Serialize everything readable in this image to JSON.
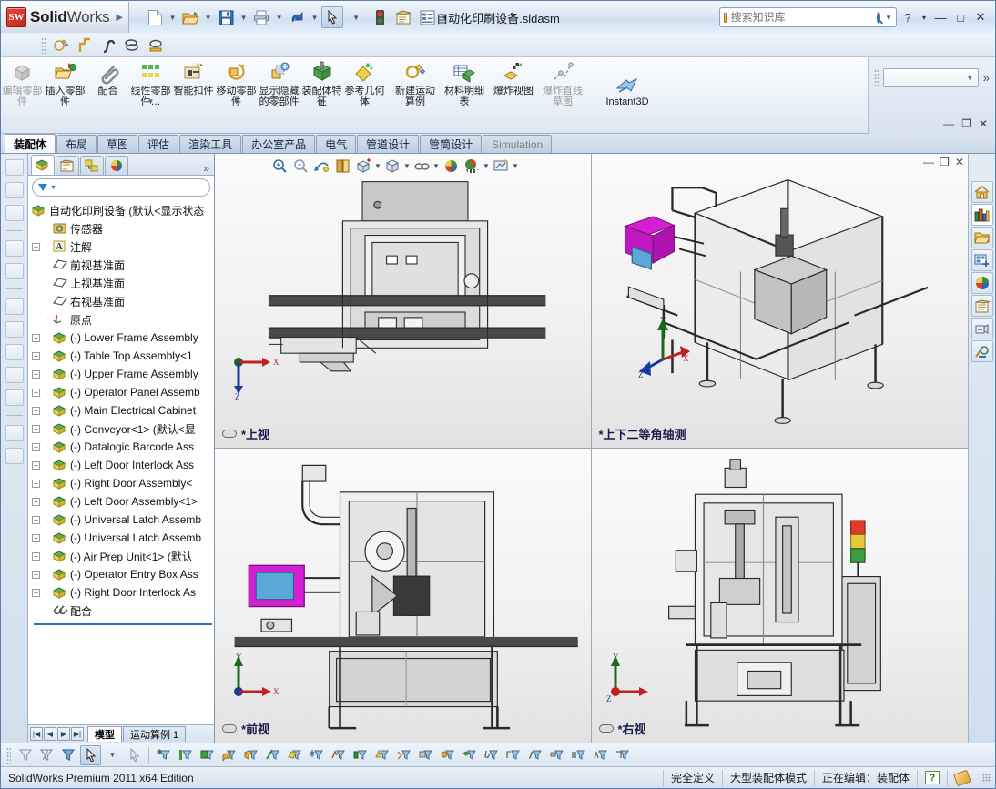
{
  "app": {
    "brand_bold": "Solid",
    "brand_light": "Works",
    "logo_text": "SW",
    "document_title": "自动化印刷设备.sldasm",
    "accent": "#2c6fc0",
    "brand_red": "#c0261b"
  },
  "search": {
    "placeholder": "搜索知识库",
    "value": "",
    "icon": "search-icon",
    "folder_icon": "folder-icon"
  },
  "window_controls": {
    "help": "?",
    "help_caret": "▾",
    "minimize": "—",
    "maximize": "□",
    "close": "✕"
  },
  "quick_access": [
    {
      "name": "new-document",
      "icon": "new-doc-icon",
      "caret": true
    },
    {
      "name": "open-document",
      "icon": "open-folder-icon",
      "caret": true
    },
    {
      "name": "save-document",
      "icon": "save-disk-icon",
      "caret": true
    },
    {
      "name": "print-document",
      "icon": "printer-icon",
      "caret": true
    },
    {
      "name": "undo",
      "icon": "undo-arrow-icon",
      "caret": true
    },
    {
      "name": "select-tool",
      "icon": "cursor-arrow-icon",
      "caret": true
    },
    {
      "name": "rebuild",
      "icon": "traffic-light-icon",
      "caret": false
    },
    {
      "name": "options",
      "icon": "options-gear-icon",
      "caret": false
    },
    {
      "name": "properties",
      "icon": "properties-list-icon",
      "caret": true
    }
  ],
  "toolbar2": [
    {
      "name": "new-motion-study",
      "icon": "motion-study-icon"
    },
    {
      "name": "curve-step",
      "icon": "step-curve-icon"
    },
    {
      "name": "curve-spline",
      "icon": "spline-curve-icon"
    },
    {
      "name": "curve-helix",
      "icon": "helix-curve-icon"
    },
    {
      "name": "curve-projected",
      "icon": "projected-curve-icon"
    }
  ],
  "ribbon": {
    "commands": [
      {
        "label": "编辑零部件",
        "icon": "edit-component-icon",
        "dropdown": false,
        "dimmed": true
      },
      {
        "label": "插入零部件",
        "icon": "insert-component-icon",
        "dropdown": true,
        "dimmed": false
      },
      {
        "label": "配合",
        "icon": "mate-paperclip-icon",
        "dropdown": false,
        "dimmed": false
      },
      {
        "label": "线性零部件…",
        "icon": "linear-pattern-icon",
        "dropdown": true,
        "dimmed": false
      },
      {
        "label": "智能扣件",
        "icon": "smart-fastener-icon",
        "dropdown": false,
        "dimmed": false
      },
      {
        "label": "移动零部件",
        "icon": "move-component-icon",
        "dropdown": true,
        "dimmed": false
      },
      {
        "label": "显示隐藏的零部件",
        "icon": "show-hidden-components-icon",
        "dropdown": false,
        "dimmed": false
      },
      {
        "label": "装配体特征",
        "icon": "assembly-feature-icon",
        "dropdown": true,
        "dimmed": false
      },
      {
        "label": "参考几何体",
        "icon": "reference-geometry-icon",
        "dropdown": true,
        "dimmed": false
      },
      {
        "label": "新建运动算例",
        "icon": "new-motion-study-icon",
        "dropdown": false,
        "dimmed": false
      },
      {
        "label": "材料明细表",
        "icon": "bill-of-materials-icon",
        "dropdown": false,
        "dimmed": false
      },
      {
        "label": "爆炸视图",
        "icon": "exploded-view-icon",
        "dropdown": false,
        "dimmed": false
      },
      {
        "label": "爆炸直线草图",
        "icon": "explode-line-sketch-icon",
        "dropdown": false,
        "dimmed": true
      },
      {
        "label": "Instant3D",
        "icon": "instant3d-icon",
        "dropdown": false,
        "dimmed": false
      }
    ],
    "config_combo_value": "",
    "expand_label": "»"
  },
  "tabs": [
    {
      "label": "装配体",
      "active": true,
      "dimmed": false
    },
    {
      "label": "布局",
      "active": false,
      "dimmed": false
    },
    {
      "label": "草图",
      "active": false,
      "dimmed": false
    },
    {
      "label": "评估",
      "active": false,
      "dimmed": false
    },
    {
      "label": "渲染工具",
      "active": false,
      "dimmed": false
    },
    {
      "label": "办公室产品",
      "active": false,
      "dimmed": false
    },
    {
      "label": "电气",
      "active": false,
      "dimmed": false
    },
    {
      "label": "管道设计",
      "active": false,
      "dimmed": false
    },
    {
      "label": "管筒设计",
      "active": false,
      "dimmed": false
    },
    {
      "label": "Simulation",
      "active": false,
      "dimmed": true
    }
  ],
  "tree_panel": {
    "tabs": [
      {
        "name": "feature-manager-tab",
        "icon": "feature-tree-icon",
        "active": true
      },
      {
        "name": "property-manager-tab",
        "icon": "property-manager-icon",
        "active": false
      },
      {
        "name": "configuration-manager-tab",
        "icon": "configuration-manager-icon",
        "active": false
      },
      {
        "name": "display-manager-tab",
        "icon": "display-manager-icon",
        "active": false
      }
    ],
    "more": "»",
    "filter_placeholder": "",
    "items": [
      {
        "label": "自动化印刷设备  (默认<显示状态",
        "icon": "assembly-icon",
        "expandable": false,
        "root": true
      },
      {
        "label": "传感器",
        "icon": "sensors-folder-icon",
        "expandable": false,
        "indent": 1
      },
      {
        "label": "注解",
        "icon": "annotations-icon",
        "expandable": true,
        "indent": 1
      },
      {
        "label": "前视基准面",
        "icon": "plane-icon",
        "expandable": false,
        "indent": 1
      },
      {
        "label": "上视基准面",
        "icon": "plane-icon",
        "expandable": false,
        "indent": 1
      },
      {
        "label": "右视基准面",
        "icon": "plane-icon",
        "expandable": false,
        "indent": 1
      },
      {
        "label": "原点",
        "icon": "origin-icon",
        "expandable": false,
        "indent": 1
      },
      {
        "label": "(-) Lower Frame Assembly",
        "icon": "component-icon",
        "expandable": true,
        "indent": 1
      },
      {
        "label": "(-) Table Top Assembly<1",
        "icon": "component-icon",
        "expandable": true,
        "indent": 1
      },
      {
        "label": "(-) Upper Frame Assembly",
        "icon": "component-icon",
        "expandable": true,
        "indent": 1
      },
      {
        "label": "(-) Operator Panel Assemb",
        "icon": "component-icon",
        "expandable": true,
        "indent": 1
      },
      {
        "label": "(-) Main Electrical Cabinet",
        "icon": "component-icon",
        "expandable": true,
        "indent": 1
      },
      {
        "label": "(-) Conveyor<1> (默认<显",
        "icon": "component-icon",
        "expandable": true,
        "indent": 1
      },
      {
        "label": "(-) Datalogic Barcode Ass",
        "icon": "component-icon",
        "expandable": true,
        "indent": 1
      },
      {
        "label": "(-) Left Door Interlock Ass",
        "icon": "component-icon",
        "expandable": true,
        "indent": 1
      },
      {
        "label": "(-) Right Door Assembly<",
        "icon": "component-icon",
        "expandable": true,
        "indent": 1
      },
      {
        "label": "(-) Left Door Assembly<1>",
        "icon": "component-icon",
        "expandable": true,
        "indent": 1
      },
      {
        "label": "(-) Universal Latch Assemb",
        "icon": "component-icon",
        "expandable": true,
        "indent": 1
      },
      {
        "label": "(-) Universal Latch Assemb",
        "icon": "component-icon",
        "expandable": true,
        "indent": 1
      },
      {
        "label": "(-) Air Prep Unit<1> (默认",
        "icon": "component-icon",
        "expandable": true,
        "indent": 1
      },
      {
        "label": "(-) Operator Entry Box Ass",
        "icon": "component-icon",
        "expandable": true,
        "indent": 1
      },
      {
        "label": "(-) Right Door Interlock As",
        "icon": "component-icon",
        "expandable": true,
        "indent": 1
      },
      {
        "label": "配合",
        "icon": "mates-folder-icon",
        "expandable": false,
        "indent": 1
      }
    ],
    "bottom_tabs": [
      {
        "label": "模型",
        "active": true
      },
      {
        "label": "运动算例 1",
        "active": false
      }
    ],
    "nav_buttons": [
      "|◀",
      "◀",
      "▶",
      "▶|"
    ]
  },
  "viewport_toolbar": [
    {
      "name": "zoom-in-out-button",
      "icon": "zoom-in-out-icon",
      "caret": false
    },
    {
      "name": "zoom-to-area-button",
      "icon": "zoom-to-area-icon",
      "caret": false
    },
    {
      "name": "previous-view-button",
      "icon": "previous-view-icon",
      "caret": false
    },
    {
      "name": "section-view-button",
      "icon": "section-view-icon",
      "caret": false
    },
    {
      "name": "view-orientation-button",
      "icon": "view-orientation-icon",
      "caret": true
    },
    {
      "name": "display-style-button",
      "icon": "display-style-icon",
      "caret": true
    },
    {
      "name": "hide-show-items-button",
      "icon": "hide-show-items-icon",
      "caret": true
    },
    {
      "name": "apply-scene-button",
      "icon": "apply-scene-icon",
      "caret": false
    },
    {
      "name": "view-setting-button",
      "icon": "view-setting-icon",
      "caret": true
    },
    {
      "name": "display-state-button",
      "icon": "display-state-icon",
      "caret": true
    }
  ],
  "viewport_window_controls": {
    "minimize": "—",
    "restore": "❐",
    "close": "✕"
  },
  "viewports": [
    {
      "label": "*上视",
      "name": "viewport-top",
      "triad": "top"
    },
    {
      "label": "*上下二等角轴测",
      "name": "viewport-dimetric",
      "triad": "iso"
    },
    {
      "label": "*前视",
      "name": "viewport-front",
      "triad": "front"
    },
    {
      "label": "*右视",
      "name": "viewport-right",
      "triad": "right"
    }
  ],
  "task_pane": [
    {
      "name": "solidworks-resources-button",
      "icon": "home-icon",
      "active": false
    },
    {
      "name": "design-library-button",
      "icon": "design-library-icon",
      "active": true
    },
    {
      "name": "file-explorer-button",
      "icon": "folder-icon",
      "active": false
    },
    {
      "name": "view-palette-button",
      "icon": "view-palette-icon",
      "active": false
    },
    {
      "name": "appearances-scenes-button",
      "icon": "appearances-icon",
      "active": false
    },
    {
      "name": "custom-properties-button",
      "icon": "custom-properties-icon",
      "active": false
    },
    {
      "name": "document-recovery-button",
      "icon": "document-recovery-icon",
      "active": false
    },
    {
      "name": "simulation-button",
      "icon": "simulation-icon",
      "active": false
    }
  ],
  "bottom_toolbar": [
    {
      "name": "filter-off-button",
      "icon": "filter-icon",
      "selected": false
    },
    {
      "name": "filter-clear-button",
      "icon": "filter-clear-icon",
      "selected": false
    },
    {
      "name": "filter-toggle-button",
      "icon": "filter-toggle-icon",
      "selected": false
    },
    {
      "name": "select-arrow-button",
      "icon": "cursor-arrow-icon",
      "selected": true
    },
    {
      "name": "select-dropdown-button",
      "icon": "chevron-down-icon",
      "selected": false
    },
    {
      "name": "select-other-button",
      "icon": "cursor-outline-icon",
      "selected": false
    },
    {
      "name": "filter-vertices-button",
      "icon": "filter-vertex-icon",
      "selected": false
    },
    {
      "name": "filter-edges-button",
      "icon": "filter-edge-icon",
      "selected": false
    },
    {
      "name": "filter-faces-button",
      "icon": "filter-face-icon",
      "selected": false
    },
    {
      "name": "filter-surface-bodies-button",
      "icon": "filter-surface-icon",
      "selected": false
    },
    {
      "name": "filter-solid-bodies-button",
      "icon": "filter-solid-icon",
      "selected": false
    },
    {
      "name": "filter-axes-button",
      "icon": "filter-axis-icon",
      "selected": false
    },
    {
      "name": "filter-planes-button",
      "icon": "filter-plane-icon",
      "selected": false
    },
    {
      "name": "filter-points-button",
      "icon": "filter-point-icon",
      "selected": false
    },
    {
      "name": "filter-sketch-button",
      "icon": "filter-sketch-icon",
      "selected": false
    },
    {
      "name": "filter-dimensions-button",
      "icon": "filter-dimension-icon",
      "selected": false
    },
    {
      "name": "filter-annotations-button",
      "icon": "filter-annotation-icon",
      "selected": false
    },
    {
      "name": "filter-weld-beads-button",
      "icon": "filter-weld-icon",
      "selected": false
    },
    {
      "name": "filter-components-button",
      "icon": "filter-component-icon",
      "selected": false
    },
    {
      "name": "filter-features-button",
      "icon": "filter-feature-icon",
      "selected": false
    },
    {
      "name": "filter-subassembly-button",
      "icon": "filter-subassembly-icon",
      "selected": false
    },
    {
      "name": "filter-mates-button",
      "icon": "filter-mate-icon",
      "selected": false
    },
    {
      "name": "filter-weldment-button",
      "icon": "filter-weldment-icon",
      "selected": false
    },
    {
      "name": "filter-routing-button",
      "icon": "filter-routing-icon",
      "selected": false
    },
    {
      "name": "filter-piping-button",
      "icon": "filter-piping-icon",
      "selected": false
    },
    {
      "name": "filter-tubing-button",
      "icon": "filter-tubing-icon",
      "selected": false
    }
  ],
  "statusbar": {
    "edition": "SolidWorks Premium 2011 x64 Edition",
    "definition_state": "完全定义",
    "assembly_mode": "大型装配体模式",
    "editing": "正在编辑：装配体",
    "help_badge": "?",
    "tag_icon": "tag-icon"
  }
}
